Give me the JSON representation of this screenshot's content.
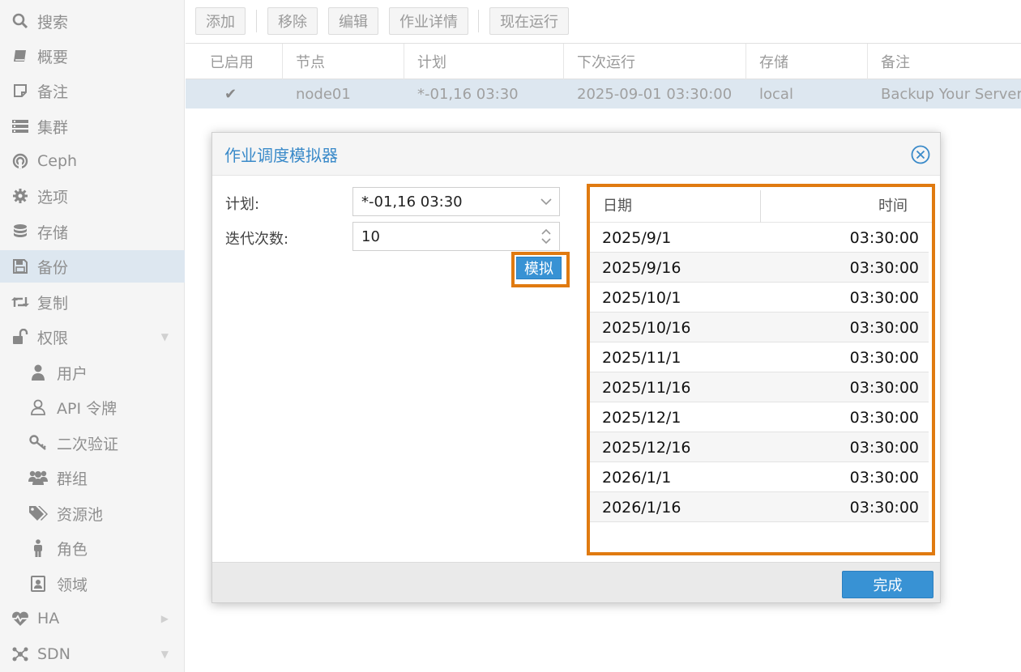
{
  "sidebar": {
    "items": [
      {
        "label": "搜索",
        "icon": "search-icon"
      },
      {
        "label": "概要",
        "icon": "book-icon"
      },
      {
        "label": "备注",
        "icon": "note-icon"
      },
      {
        "label": "集群",
        "icon": "server-icon"
      },
      {
        "label": "Ceph",
        "icon": "ceph-icon"
      },
      {
        "label": "选项",
        "icon": "gear-icon"
      },
      {
        "label": "存储",
        "icon": "database-icon"
      },
      {
        "label": "备份",
        "icon": "floppy-icon"
      },
      {
        "label": "复制",
        "icon": "retweet-icon"
      },
      {
        "label": "权限",
        "icon": "unlock-icon"
      },
      {
        "label": "用户",
        "icon": "user-icon"
      },
      {
        "label": "API 令牌",
        "icon": "user-outline-icon"
      },
      {
        "label": "二次验证",
        "icon": "key-icon"
      },
      {
        "label": "群组",
        "icon": "users-icon"
      },
      {
        "label": "资源池",
        "icon": "tags-icon"
      },
      {
        "label": "角色",
        "icon": "male-icon"
      },
      {
        "label": "领域",
        "icon": "address-book-icon"
      },
      {
        "label": "HA",
        "icon": "heartbeat-icon"
      },
      {
        "label": "SDN",
        "icon": "network-icon"
      }
    ],
    "active": "备份"
  },
  "toolbar": {
    "add": "添加",
    "remove": "移除",
    "edit": "编辑",
    "job_detail": "作业详情",
    "run_now": "现在运行"
  },
  "grid": {
    "columns": [
      "已启用",
      "节点",
      "计划",
      "下次运行",
      "存储",
      "备注"
    ],
    "row": {
      "enabled": "✔",
      "node": "node01",
      "schedule": "*-01,16 03:30",
      "next_run": "2025-09-01 03:30:00",
      "storage": "local",
      "comment": "Backup Your Server"
    }
  },
  "modal": {
    "title": "作业调度模拟器",
    "schedule_label": "计划:",
    "schedule_value": "*-01,16 03:30",
    "iterations_label": "迭代次数:",
    "iterations_value": "10",
    "simulate_button": "模拟",
    "result_date_header": "日期",
    "result_time_header": "时间",
    "results": [
      {
        "date": "2025/9/1",
        "time": "03:30:00"
      },
      {
        "date": "2025/9/16",
        "time": "03:30:00"
      },
      {
        "date": "2025/10/1",
        "time": "03:30:00"
      },
      {
        "date": "2025/10/16",
        "time": "03:30:00"
      },
      {
        "date": "2025/11/1",
        "time": "03:30:00"
      },
      {
        "date": "2025/11/16",
        "time": "03:30:00"
      },
      {
        "date": "2025/12/1",
        "time": "03:30:00"
      },
      {
        "date": "2025/12/16",
        "time": "03:30:00"
      },
      {
        "date": "2026/1/1",
        "time": "03:30:00"
      },
      {
        "date": "2026/1/16",
        "time": "03:30:00"
      }
    ],
    "done_button": "完成"
  },
  "colors": {
    "accent": "#3892d4",
    "highlight": "#e07a10",
    "selection": "#dde7f0"
  }
}
